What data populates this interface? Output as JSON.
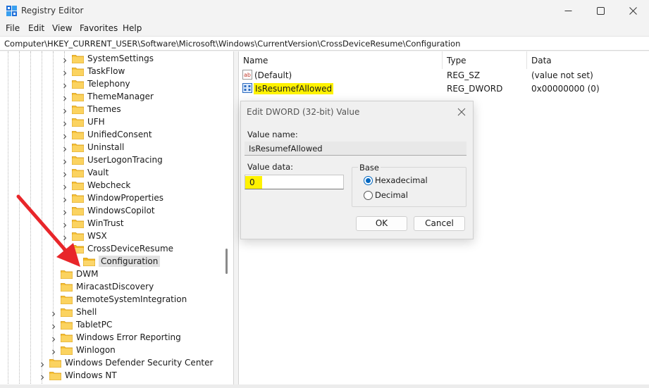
{
  "window": {
    "title": "Registry Editor"
  },
  "menu": [
    "File",
    "Edit",
    "View",
    "Favorites",
    "Help"
  ],
  "address": "Computer\\HKEY_CURRENT_USER\\Software\\Microsoft\\Windows\\CurrentVersion\\CrossDeviceResume\\Configuration",
  "tree": {
    "children": [
      "SystemSettings",
      "TaskFlow",
      "Telephony",
      "ThemeManager",
      "Themes",
      "UFH",
      "UnifiedConsent",
      "Uninstall",
      "UserLogonTracing",
      "Vault",
      "Webcheck",
      "WindowProperties",
      "WindowsCopilot",
      "WinTrust",
      "WSX"
    ],
    "expanded": "CrossDeviceResume",
    "selected": "Configuration",
    "siblings": [
      "DWM",
      "MiracastDiscovery",
      "RemoteSystemIntegration",
      "Shell",
      "TabletPC",
      "Windows Error Reporting",
      "Winlogon"
    ],
    "outer": [
      "Windows Defender Security Center",
      "Windows NT"
    ]
  },
  "list": {
    "columns": [
      "Name",
      "Type",
      "Data"
    ],
    "rows": [
      {
        "name": "(Default)",
        "type": "REG_SZ",
        "data": "(value not set)",
        "icon": "string-value-icon"
      },
      {
        "name": "IsResumefAllowed",
        "type": "REG_DWORD",
        "data": "0x00000000 (0)",
        "icon": "dword-value-icon"
      }
    ]
  },
  "dialog": {
    "title": "Edit DWORD (32-bit) Value",
    "value_name_label": "Value name:",
    "value_name": "IsResumefAllowed",
    "value_data_label": "Value data:",
    "value_data": "0",
    "base_label": "Base",
    "base_options": [
      "Hexadecimal",
      "Decimal"
    ],
    "base_selected": "Hexadecimal",
    "ok_label": "OK",
    "cancel_label": "Cancel"
  },
  "colors": {
    "highlight": "#fff200",
    "arrow": "#e8262a",
    "folder": "#f8c33a",
    "accent": "#0067c0"
  }
}
